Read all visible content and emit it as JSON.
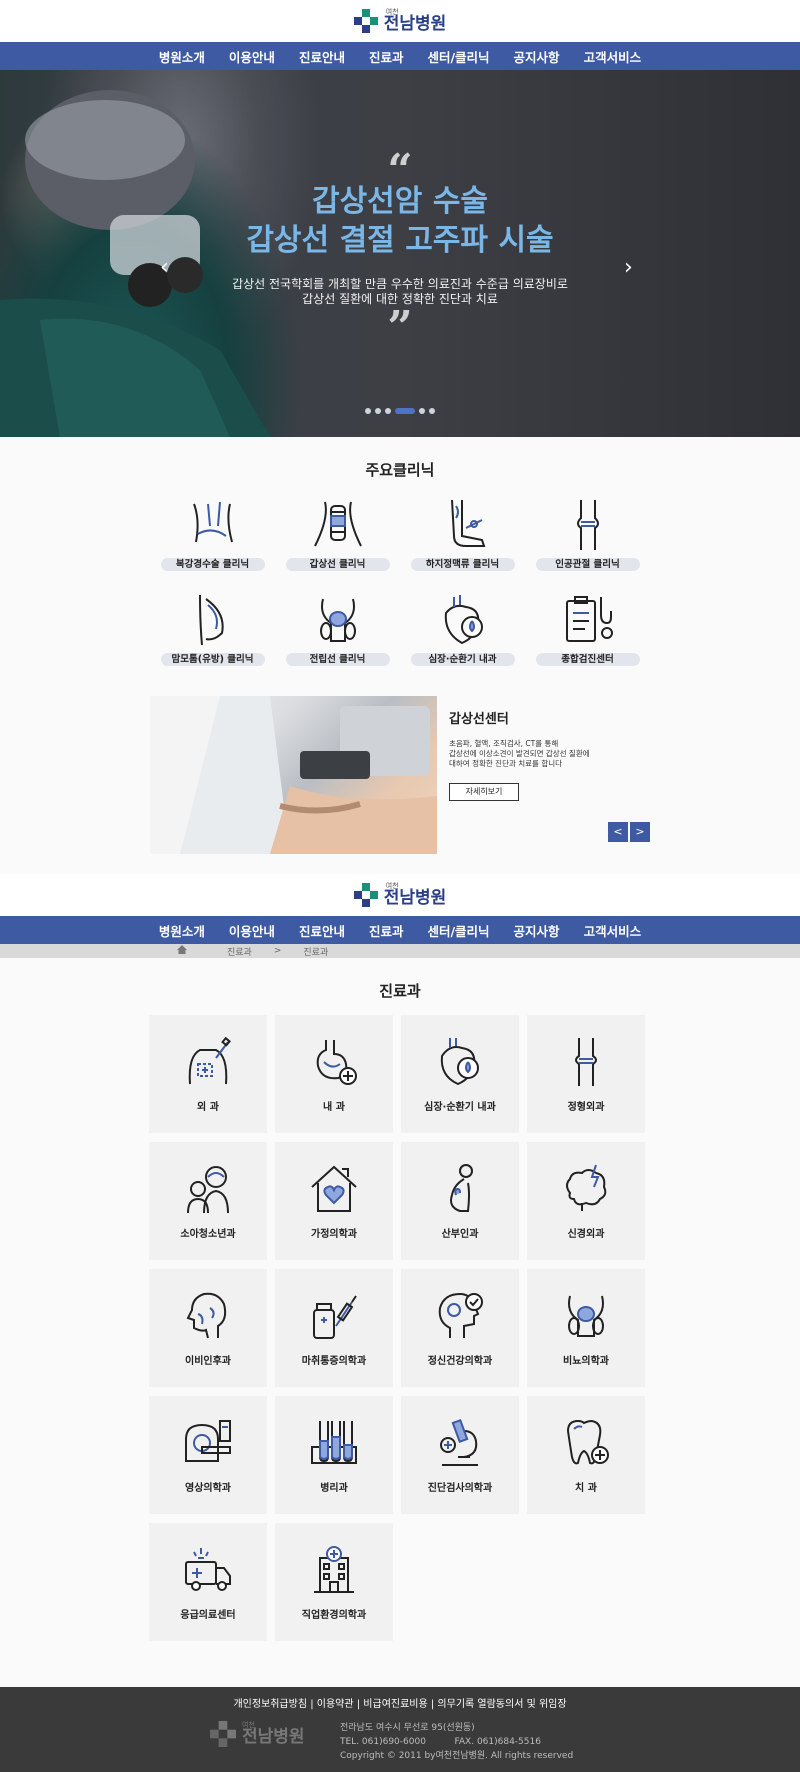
{
  "header": {
    "logo_small": "여천",
    "logo_name": "전남병원",
    "nav": [
      "병원소개",
      "이용안내",
      "진료안내",
      "진료과",
      "센터/클리닉",
      "공지사항",
      "고객서비스"
    ]
  },
  "hero": {
    "title_line1": "갑상선암 수술",
    "title_line2": "갑상선 결절 고주파 시술",
    "sub_line1": "갑상선 전국학회를 개최할 만큼 우수한 의료진과 수준급 의료장비로",
    "sub_line2": "갑상선 질환에 대한 정확한 진단과 치료",
    "quote_open": "“",
    "quote_close": "”",
    "prev": "‹",
    "next": "›",
    "slide_count": 6,
    "active_slide": 4
  },
  "clinics": {
    "title": "주요클리닉",
    "items": [
      {
        "label": "복강경수술 클리닉",
        "icon": "abdomen-icon"
      },
      {
        "label": "갑상선 클리닉",
        "icon": "thyroid-icon"
      },
      {
        "label": "하지정맥류 클리닉",
        "icon": "leg-vein-icon"
      },
      {
        "label": "인공관절 클리닉",
        "icon": "joint-icon"
      },
      {
        "label": "맘모톰(유방) 클리닉",
        "icon": "breast-icon"
      },
      {
        "label": "전립선 클리닉",
        "icon": "prostate-icon"
      },
      {
        "label": "심장·순환기 내과",
        "icon": "heart-icon"
      },
      {
        "label": "종합검진센터",
        "icon": "checkup-icon"
      }
    ]
  },
  "feature": {
    "title": "갑상선센터",
    "desc_line1": "초음파, 혈액, 조직검사, CT를 통해",
    "desc_line2": "갑상선에 이상소견이 발견되면 갑상선 질환에",
    "desc_line3": "대하여 정확한 진단과 치료를 합니다",
    "more": "자세히보기",
    "prev": "<",
    "next": ">"
  },
  "breadcrumb": {
    "home_icon": "home-icon",
    "level1": "진료과",
    "sep": ">",
    "level2": "진료과"
  },
  "departments": {
    "title": "진료과",
    "items": [
      {
        "label": "외 과",
        "icon": "surgery-icon"
      },
      {
        "label": "내 과",
        "icon": "stomach-icon"
      },
      {
        "label": "심장·순환기 내과",
        "icon": "heart-icon"
      },
      {
        "label": "정형외과",
        "icon": "bone-icon"
      },
      {
        "label": "소아청소년과",
        "icon": "child-icon"
      },
      {
        "label": "가정의학과",
        "icon": "house-heart-icon"
      },
      {
        "label": "산부인과",
        "icon": "pregnancy-icon"
      },
      {
        "label": "신경외과",
        "icon": "brain-icon"
      },
      {
        "label": "이비인후과",
        "icon": "ent-icon"
      },
      {
        "label": "마취통증의학과",
        "icon": "syringe-icon"
      },
      {
        "label": "정신건강의학과",
        "icon": "mind-icon"
      },
      {
        "label": "비뇨의학과",
        "icon": "urology-icon"
      },
      {
        "label": "영상의학과",
        "icon": "mri-icon"
      },
      {
        "label": "병리과",
        "icon": "test-tube-icon"
      },
      {
        "label": "진단검사의학과",
        "icon": "microscope-icon"
      },
      {
        "label": "치 과",
        "icon": "tooth-icon"
      },
      {
        "label": "응급의료센터",
        "icon": "ambulance-icon"
      },
      {
        "label": "직업환경의학과",
        "icon": "hospital-icon"
      }
    ]
  },
  "footer": {
    "links": "개인정보취급방침  |  이용약관  |  비급여진료비용  |  의무기록 열람동의서 및 위임장",
    "address": "전라남도 여수시 무선로 95(선원동)",
    "phone": "TEL. 061)690-6000          FAX. 061)684-5516",
    "copyright": "Copyright © 2011 by여천전남병원. All rights reserved"
  },
  "colors": {
    "brand": "#3d5aa3",
    "hero_title": "#7ab6e6",
    "accent_green": "#1b8f7a"
  }
}
